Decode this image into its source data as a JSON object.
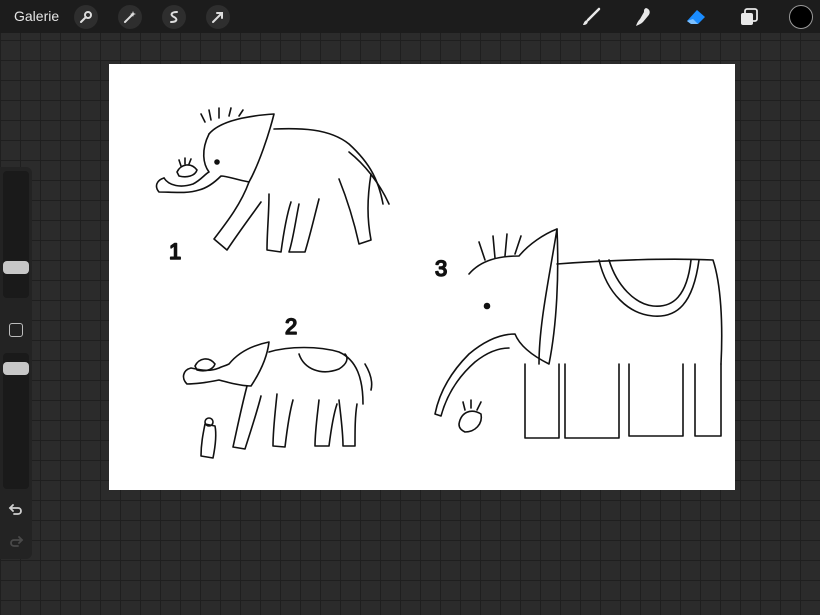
{
  "topbar": {
    "gallery_label": "Galerie",
    "left_tools": [
      "wrench-icon",
      "magic-wand-icon",
      "selection-icon",
      "transform-arrow-icon"
    ],
    "right_tools": [
      "brush-icon",
      "smudge-icon",
      "eraser-icon",
      "layers-icon"
    ],
    "active_tool": "eraser-icon",
    "current_color": "#000000",
    "active_color_accent": "#1a8cff"
  },
  "sidebar": {
    "size_slider_level": 0.35,
    "opacity_slider_level": 0.9,
    "icons": [
      "modify-square-icon",
      "undo-icon",
      "redo-icon"
    ]
  },
  "canvas": {
    "labels": [
      "1",
      "2",
      "3"
    ]
  }
}
